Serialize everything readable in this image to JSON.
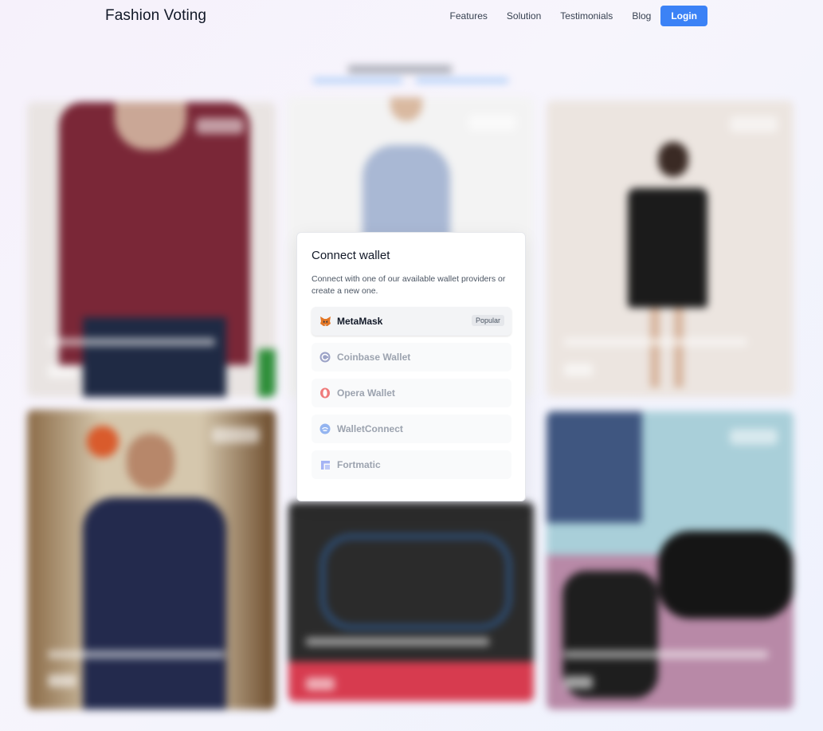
{
  "header": {
    "logo": "Fashion Voting",
    "nav": [
      "Features",
      "Solution",
      "Testimonials",
      "Blog"
    ],
    "login": "Login"
  },
  "modal": {
    "title": "Connect wallet",
    "description": "Connect with one of our available wallet providers or create a new one.",
    "wallets": [
      {
        "label": "MetaMask",
        "badge": "Popular",
        "icon": "metamask-icon"
      },
      {
        "label": "Coinbase Wallet",
        "icon": "coinbase-icon"
      },
      {
        "label": "Opera Wallet",
        "icon": "opera-icon"
      },
      {
        "label": "WalletConnect",
        "icon": "walletconnect-icon"
      },
      {
        "label": "Fortmatic",
        "icon": "fortmatic-icon"
      }
    ]
  },
  "colors": {
    "accent": "#3b82f6",
    "background": "#f6f1fb"
  }
}
